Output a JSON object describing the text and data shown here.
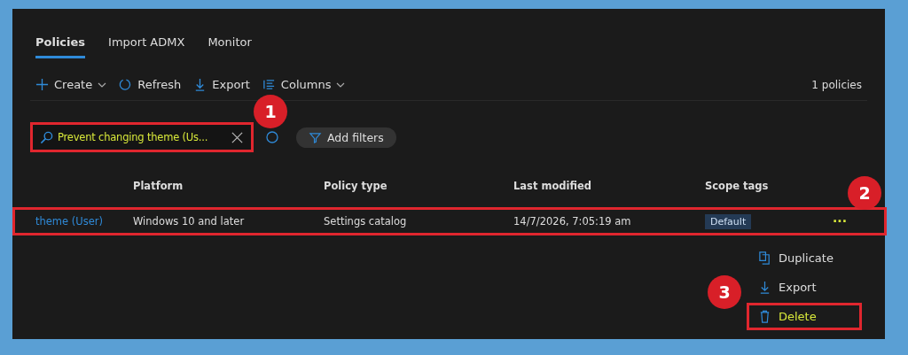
{
  "tabs": [
    {
      "label": "Policies",
      "selected": true
    },
    {
      "label": "Import ADMX",
      "selected": false
    },
    {
      "label": "Monitor",
      "selected": false
    }
  ],
  "toolbar": [
    {
      "kind": "create",
      "label": "Create",
      "dropdown": true
    },
    {
      "kind": "refresh",
      "label": "Refresh",
      "dropdown": false
    },
    {
      "kind": "export",
      "label": "Export",
      "dropdown": false
    },
    {
      "kind": "columns",
      "label": "Columns",
      "dropdown": true
    }
  ],
  "count": "1 policies",
  "search": {
    "value": "Prevent changing theme (Us...",
    "annotated": true,
    "badge": "1"
  },
  "add_filters": "Add filters",
  "table": {
    "columns": [
      "Platform",
      "Policy type",
      "Last modified",
      "Scope tags"
    ],
    "rows": [
      {
        "name": "theme (User)",
        "platform": "Windows 10 and later",
        "policy_type": "Settings catalog",
        "last_modified": "14/7/2026, 7:05:19 am",
        "scope_tag": "Default",
        "actions": "···",
        "annotated": true,
        "badge": "2"
      }
    ]
  },
  "context_menu": {
    "badge": "3",
    "items": [
      {
        "kind": "duplicate",
        "label": "Duplicate",
        "highlighted": false
      },
      {
        "kind": "export",
        "label": "Export",
        "highlighted": false
      },
      {
        "kind": "delete",
        "label": "Delete",
        "highlighted": true
      }
    ]
  }
}
